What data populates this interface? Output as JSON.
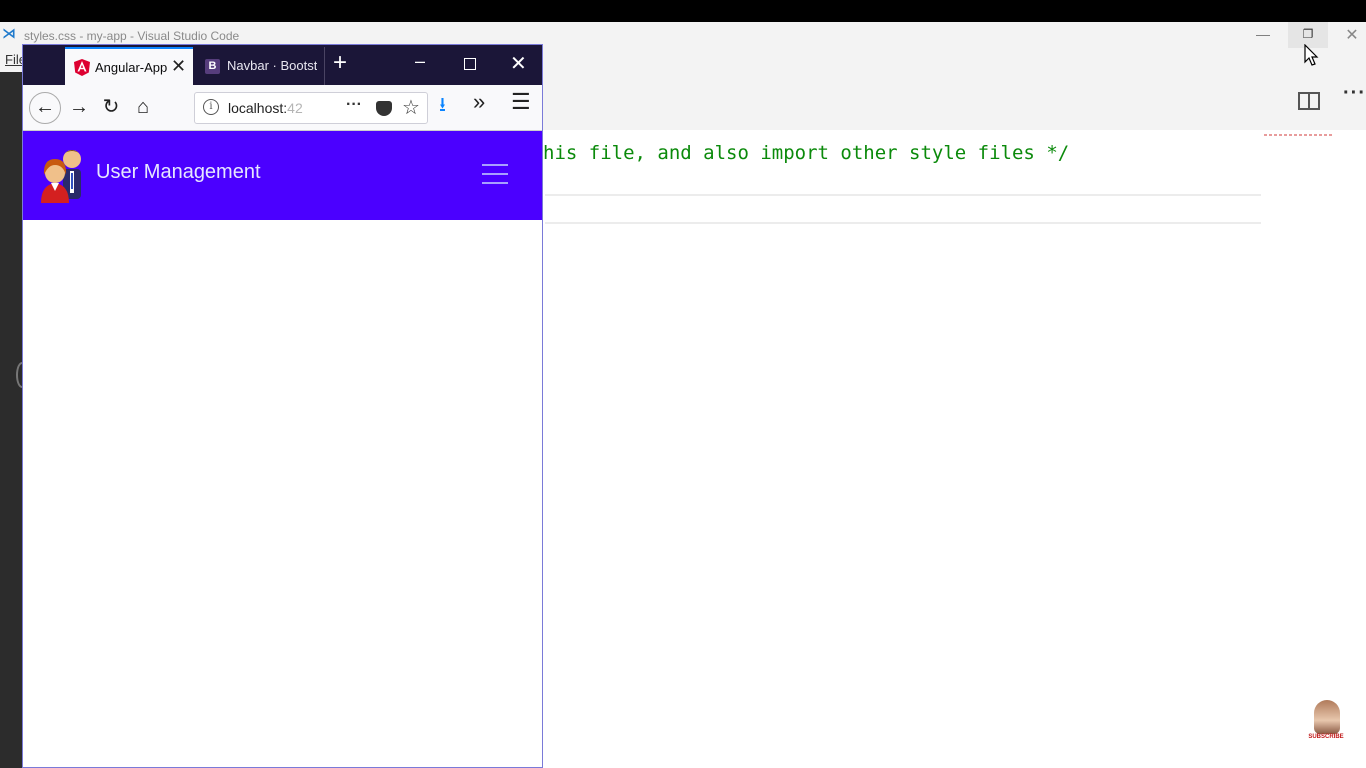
{
  "vscode": {
    "window_title": "styles.css - my-app - Visual Studio Code",
    "logo_glyph": "⋊",
    "menu_file": "File",
    "min_glyph": "—",
    "restore_glyph": "❐",
    "close_glyph": "✕",
    "more_glyph": "···",
    "code_line": "his file, and also import other style files */"
  },
  "firefox": {
    "tabs": [
      {
        "label": "Angular-App",
        "close": "✕"
      },
      {
        "label": "Navbar · Bootstr",
        "icon_letter": "B"
      }
    ],
    "new_tab_glyph": "+",
    "window_controls": {
      "min": "–",
      "close": "✕"
    },
    "toolbar": {
      "back": "←",
      "forward": "→",
      "reload": "↻",
      "home": "⌂",
      "url_host": "localhost:",
      "url_port_faded": "42",
      "url_info": "i",
      "page_actions": "···",
      "bookmark": "☆",
      "download": "⭳",
      "overflow": "»",
      "menu": "☰"
    }
  },
  "app": {
    "brand": "User Management",
    "navbar_color": "#4b00ff"
  },
  "overlay": {
    "subscribe_label": "SUBSCRIBE"
  }
}
